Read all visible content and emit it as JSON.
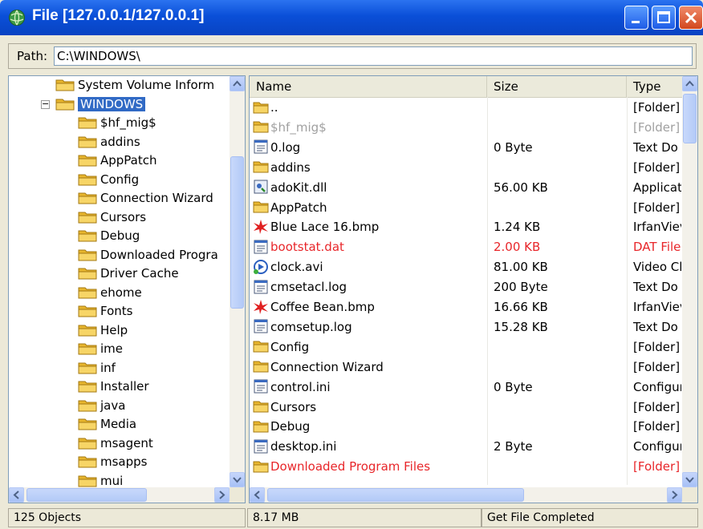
{
  "window": {
    "title": "File [127.0.0.1/127.0.0.1]"
  },
  "path": {
    "label": "Path:",
    "value": "C:\\WINDOWS\\"
  },
  "tree": {
    "items": [
      {
        "label": "System Volume Inform",
        "depth": 1
      },
      {
        "label": "WINDOWS",
        "depth": 1,
        "selected": true,
        "expanded": true
      },
      {
        "label": "$hf_mig$",
        "depth": 2
      },
      {
        "label": "addins",
        "depth": 2
      },
      {
        "label": "AppPatch",
        "depth": 2
      },
      {
        "label": "Config",
        "depth": 2
      },
      {
        "label": "Connection Wizard",
        "depth": 2
      },
      {
        "label": "Cursors",
        "depth": 2
      },
      {
        "label": "Debug",
        "depth": 2
      },
      {
        "label": "Downloaded Progra",
        "depth": 2
      },
      {
        "label": "Driver Cache",
        "depth": 2
      },
      {
        "label": "ehome",
        "depth": 2
      },
      {
        "label": "Fonts",
        "depth": 2
      },
      {
        "label": "Help",
        "depth": 2
      },
      {
        "label": "ime",
        "depth": 2
      },
      {
        "label": "inf",
        "depth": 2
      },
      {
        "label": "Installer",
        "depth": 2
      },
      {
        "label": "java",
        "depth": 2
      },
      {
        "label": "Media",
        "depth": 2
      },
      {
        "label": "msagent",
        "depth": 2
      },
      {
        "label": "msapps",
        "depth": 2
      },
      {
        "label": "mui",
        "depth": 2
      }
    ]
  },
  "list": {
    "columns": [
      "Name",
      "Size",
      "Type"
    ],
    "rows": [
      {
        "name": "..",
        "size": "",
        "type": "[Folder]",
        "icon": "folder-icon",
        "style": "normal"
      },
      {
        "name": "$hf_mig$",
        "size": "",
        "type": "[Folder]",
        "icon": "folder-icon",
        "style": "hidden"
      },
      {
        "name": "0.log",
        "size": "0 Byte",
        "type": "Text Do",
        "icon": "text-file-icon",
        "style": "normal"
      },
      {
        "name": "addins",
        "size": "",
        "type": "[Folder]",
        "icon": "folder-icon",
        "style": "normal"
      },
      {
        "name": "adoKit.dll",
        "size": "56.00 KB",
        "type": "Applicati",
        "icon": "dll-icon",
        "style": "normal"
      },
      {
        "name": "AppPatch",
        "size": "",
        "type": "[Folder]",
        "icon": "folder-icon",
        "style": "normal"
      },
      {
        "name": "Blue Lace 16.bmp",
        "size": "1.24 KB",
        "type": "IrfanViev",
        "icon": "irfanview-icon",
        "style": "normal"
      },
      {
        "name": "bootstat.dat",
        "size": "2.00 KB",
        "type": "DAT File",
        "icon": "text-file-icon",
        "style": "system"
      },
      {
        "name": "clock.avi",
        "size": "81.00 KB",
        "type": "Video Cl",
        "icon": "video-icon",
        "style": "normal"
      },
      {
        "name": "cmsetacl.log",
        "size": "200 Byte",
        "type": "Text Do",
        "icon": "text-file-icon",
        "style": "normal"
      },
      {
        "name": "Coffee Bean.bmp",
        "size": "16.66 KB",
        "type": "IrfanViev",
        "icon": "irfanview-icon",
        "style": "normal"
      },
      {
        "name": "comsetup.log",
        "size": "15.28 KB",
        "type": "Text Do",
        "icon": "text-file-icon",
        "style": "normal"
      },
      {
        "name": "Config",
        "size": "",
        "type": "[Folder]",
        "icon": "folder-icon",
        "style": "normal"
      },
      {
        "name": "Connection Wizard",
        "size": "",
        "type": "[Folder]",
        "icon": "folder-icon",
        "style": "normal"
      },
      {
        "name": "control.ini",
        "size": "0 Byte",
        "type": "Configur",
        "icon": "text-file-icon",
        "style": "normal"
      },
      {
        "name": "Cursors",
        "size": "",
        "type": "[Folder]",
        "icon": "folder-icon",
        "style": "normal"
      },
      {
        "name": "Debug",
        "size": "",
        "type": "[Folder]",
        "icon": "folder-icon",
        "style": "normal"
      },
      {
        "name": "desktop.ini",
        "size": "2 Byte",
        "type": "Configur",
        "icon": "text-file-icon",
        "style": "normal"
      },
      {
        "name": "Downloaded Program Files",
        "size": "",
        "type": "[Folder]",
        "icon": "folder-icon",
        "style": "system"
      }
    ]
  },
  "status": {
    "objects": "125 Objects",
    "size": "8.17 MB",
    "message": "Get File Completed"
  },
  "colors": {
    "system_text": "#e8262a",
    "hidden_text": "#a0a0a0",
    "selection": "#316ac5",
    "title_bar": "#0a4fd8"
  }
}
